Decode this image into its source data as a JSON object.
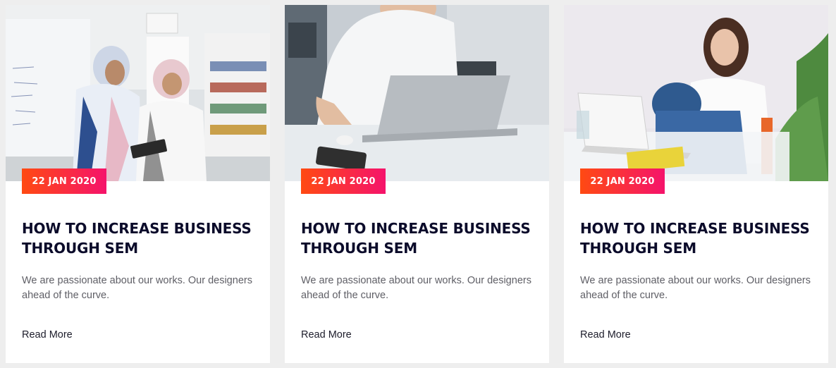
{
  "posts": [
    {
      "date": "22 JAN 2020",
      "title": "HOW TO INCREASE BUSINESS THROUGH SEM",
      "excerpt": "We are passionate about our works. Our designers ahead of the curve.",
      "read_more": "Read More",
      "image": "two-women-with-tablet-photo"
    },
    {
      "date": "22 JAN 2020",
      "title": "HOW TO INCREASE BUSINESS THROUGH SEM",
      "excerpt": "We are passionate about our works. Our designers ahead of the curve.",
      "read_more": "Read More",
      "image": "woman-at-laptop-desk-photo"
    },
    {
      "date": "22 JAN 2020",
      "title": "HOW TO INCREASE BUSINESS THROUGH SEM",
      "excerpt": "We are passionate about our works. Our designers ahead of the curve.",
      "read_more": "Read More",
      "image": "woman-sitting-with-laptop-photo"
    }
  ],
  "colors": {
    "badge_start": "#ff4a12",
    "badge_end": "#f5136b",
    "title": "#0b0b2a",
    "excerpt": "#5f5f66"
  }
}
